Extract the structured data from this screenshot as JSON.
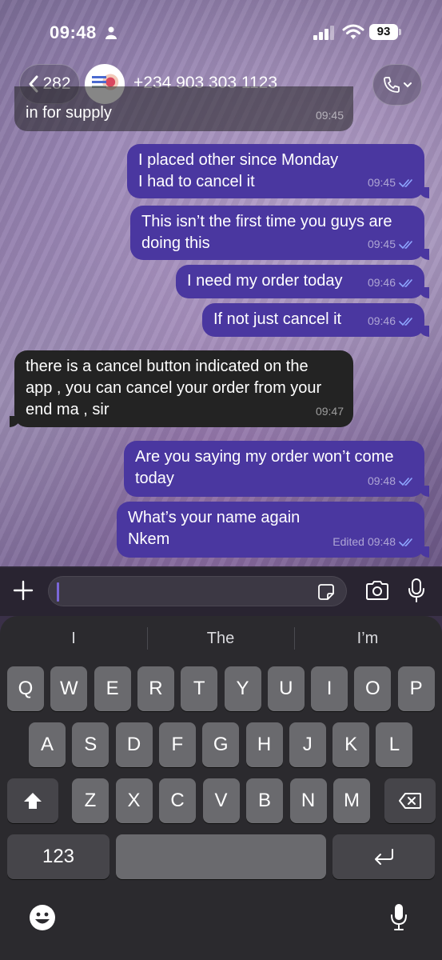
{
  "status": {
    "time": "09:48",
    "battery": "93"
  },
  "header": {
    "back_count": "282",
    "contact": "+234 903 303 1123"
  },
  "messages": [
    {
      "dir": "in",
      "lines": [
        "in for supply"
      ],
      "time": "09:45",
      "edited": ""
    },
    {
      "dir": "out",
      "lines": [
        "I placed other since Monday",
        "I had to cancel it"
      ],
      "time": "09:45",
      "edited": ""
    },
    {
      "dir": "out",
      "lines": [
        "This isn’t the first time you guys are",
        "doing this"
      ],
      "time": "09:45",
      "edited": ""
    },
    {
      "dir": "out",
      "lines": [
        "I need my order today"
      ],
      "time": "09:46",
      "edited": ""
    },
    {
      "dir": "out",
      "lines": [
        "If not just cancel it"
      ],
      "time": "09:46",
      "edited": ""
    },
    {
      "dir": "in",
      "lines": [
        "there is a cancel button indicated on the",
        "app , you can cancel your order from your",
        "end ma , sir"
      ],
      "time": "09:47",
      "edited": ""
    },
    {
      "dir": "out",
      "lines": [
        "Are you saying my order won’t come",
        "today"
      ],
      "time": "09:48",
      "edited": ""
    },
    {
      "dir": "out",
      "lines": [
        "What’s your name again",
        "Nkem"
      ],
      "time": "09:48",
      "edited": "Edited"
    }
  ],
  "composer": {
    "placeholder": ""
  },
  "keyboard": {
    "suggestions": [
      "I",
      "The",
      "I’m"
    ],
    "row1": [
      "Q",
      "W",
      "E",
      "R",
      "T",
      "Y",
      "U",
      "I",
      "O",
      "P"
    ],
    "row2": [
      "A",
      "S",
      "D",
      "F",
      "G",
      "H",
      "J",
      "K",
      "L"
    ],
    "row3": [
      "Z",
      "X",
      "C",
      "V",
      "B",
      "N",
      "M"
    ],
    "numbers_key": "123",
    "space_key": ""
  },
  "colors": {
    "outgoing": "#4a37a0",
    "incoming": "#232323",
    "read_check": "#8ea6ff"
  }
}
